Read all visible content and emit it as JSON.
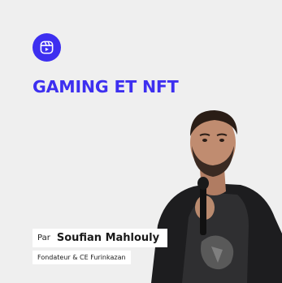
{
  "badge": {
    "icon": "video-reel-icon",
    "color": "#3d2ff0"
  },
  "title": "GAMING ET NFT",
  "speaker": {
    "prefix": "Par",
    "name": "Soufian Mahlouly",
    "role": "Fondateur & CE Furinkazan"
  },
  "colors": {
    "accent": "#3d2ff0",
    "background": "#efefef",
    "label_bg": "#ffffff"
  }
}
